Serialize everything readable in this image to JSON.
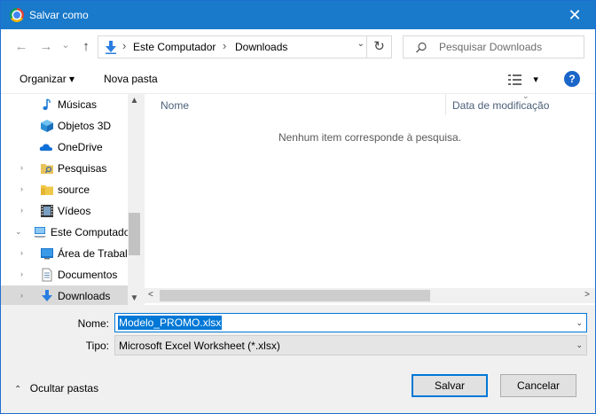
{
  "window": {
    "title": "Salvar como",
    "close_glyph": "✕"
  },
  "nav": {
    "back_glyph": "←",
    "forward_glyph": "→",
    "history_glyph": "⌄",
    "up_glyph": "↑",
    "breadcrumb": [
      "Este Computador",
      "Downloads"
    ],
    "separator": "›",
    "address_history_glyph": "⌄",
    "refresh_glyph": "↻"
  },
  "search": {
    "placeholder": "Pesquisar Downloads"
  },
  "toolbar": {
    "organize_label": "Organizar ▾",
    "new_folder_label": "Nova pasta",
    "views_glyph": "▾",
    "help_label": "?"
  },
  "sidebar": {
    "items": [
      {
        "label": "Músicas",
        "icon": "music-note-icon",
        "arrow": "",
        "selected": false
      },
      {
        "label": "Objetos 3D",
        "icon": "cube-3d-icon",
        "arrow": "",
        "selected": false
      },
      {
        "label": "OneDrive",
        "icon": "cloud-icon",
        "arrow": "",
        "selected": false
      },
      {
        "label": "Pesquisas",
        "icon": "folder-icon",
        "arrow": "›",
        "selected": false
      },
      {
        "label": "source",
        "icon": "folder-icon",
        "arrow": "›",
        "selected": false
      },
      {
        "label": "Vídeos",
        "icon": "film-icon",
        "arrow": "›",
        "selected": false
      },
      {
        "label": "Este Computado",
        "icon": "computer-icon",
        "arrow": "⌄",
        "selected": false
      },
      {
        "label": "Área de Trabalh",
        "icon": "desktop-icon",
        "arrow": "›",
        "selected": false
      },
      {
        "label": "Documentos",
        "icon": "document-icon",
        "arrow": "›",
        "selected": false
      },
      {
        "label": "Downloads",
        "icon": "download-icon",
        "arrow": "›",
        "selected": true
      }
    ],
    "scroll_up": "▲",
    "scroll_down": "▼"
  },
  "filelist": {
    "columns": [
      "Nome",
      "Data de modificação"
    ],
    "sort_glyph": "⌄",
    "empty_message": "Nenhum item corresponde à pesquisa.",
    "hscroll_left": "<",
    "hscroll_right": ">"
  },
  "form": {
    "name_label": "Nome:",
    "name_value": "Modelo_PROMO.xlsx",
    "type_label": "Tipo:",
    "type_value": "Microsoft Excel Worksheet (*.xlsx)",
    "dropdown_glyph": "⌄"
  },
  "footer": {
    "hide_folders_chevron": "⌃",
    "hide_folders_label": "Ocultar pastas",
    "save_label": "Salvar",
    "cancel_label": "Cancelar"
  },
  "colors": {
    "titlebar": "#1979ca",
    "accent": "#0078d7"
  }
}
